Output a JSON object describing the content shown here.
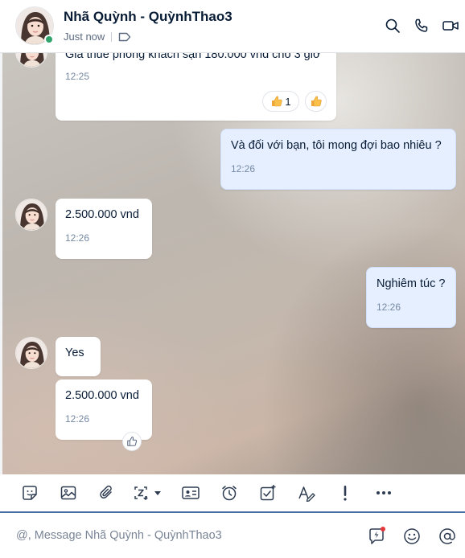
{
  "header": {
    "title": "Nhã Quỳnh - QuỳnhThao3",
    "status": "Just now",
    "icons": [
      "tag-icon",
      "search-icon",
      "phone-icon",
      "video-call-icon"
    ]
  },
  "messages": {
    "m1": {
      "text": "Giá thuê phòng khách sạn 180.000 vnđ cho 3 giờ",
      "time": "12:25",
      "reaction_count": "1"
    },
    "m2": {
      "text": "Và đối với bạn, tôi mong đợi bao nhiêu ?",
      "time": "12:26"
    },
    "m3": {
      "text": "2.500.000 vnd",
      "time": "12:26"
    },
    "m4": {
      "text": "Nghiêm túc ?",
      "time": "12:26"
    },
    "m5": {
      "text": "Yes"
    },
    "m6": {
      "text": "2.500.000 vnd",
      "time": "12:26"
    }
  },
  "toolbar": {
    "icons": [
      "sticker-icon",
      "image-icon",
      "attachment-icon",
      "screenshot-icon",
      "contact-card-icon",
      "reminder-icon",
      "task-icon",
      "text-format-icon",
      "urgent-icon",
      "more-icon"
    ]
  },
  "composer": {
    "placeholder": "@, Message Nhã Quỳnh - QuỳnhThao3",
    "value": ""
  },
  "colors": {
    "accent": "#0068ff",
    "online": "#30a46c",
    "outgoing_bubble": "#e5efff",
    "incoming_bubble": "#ffffff",
    "toolbar_underline": "#4a6fa5"
  }
}
